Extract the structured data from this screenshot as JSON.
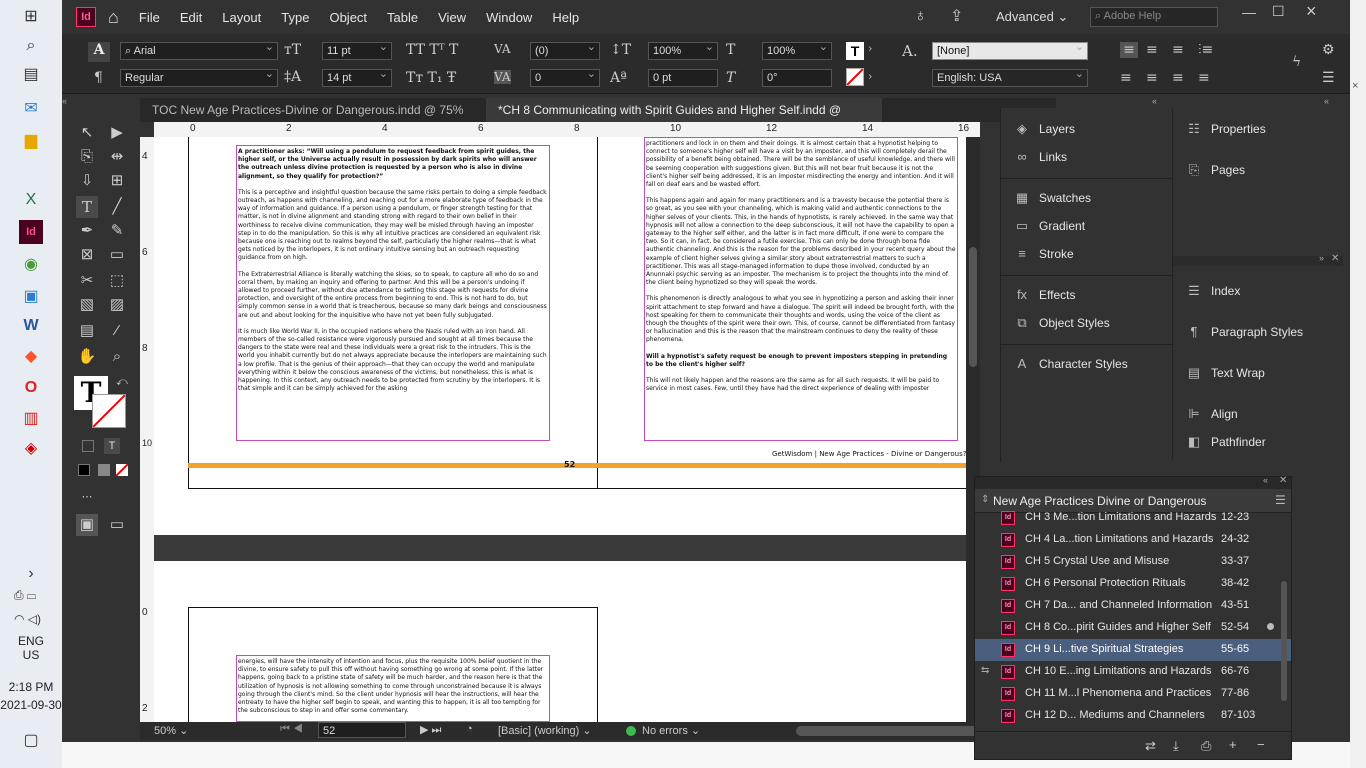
{
  "taskbar": {
    "time": "2:18 PM",
    "date": "2021-09-30",
    "lang1": "ENG",
    "lang2": "US"
  },
  "menubar": {
    "app_icon": "Id",
    "items": [
      "File",
      "Edit",
      "Layout",
      "Type",
      "Object",
      "Table",
      "View",
      "Window",
      "Help"
    ],
    "workspace": "Advanced",
    "search_placeholder": "Adobe Help"
  },
  "control": {
    "font": "Arial",
    "style": "Regular",
    "size": "11 pt",
    "leading": "14 pt",
    "kerning": "(0)",
    "tracking": "0",
    "vscale": "100%",
    "hscale": "100%",
    "baseline": "0 pt",
    "skew": "0°",
    "char_style": "[None]",
    "language": "English: USA"
  },
  "tabs": [
    {
      "label": "TOC New Age Practices-Divine or Dangerous.indd @ 75%"
    },
    {
      "label": "*CH 8 Communicating with Spirit Guides and Higher Self.indd @ 50%"
    }
  ],
  "ruler": {
    "h": [
      "0",
      "2",
      "4",
      "6",
      "8",
      "10",
      "12",
      "14",
      "16"
    ],
    "v": [
      "4",
      "6",
      "8",
      "10",
      "0",
      "2"
    ]
  },
  "document": {
    "left_col": [
      "A practitioner asks: “Will using a pendulum to request feedback from spirit guides, the higher self, or the Universe actually result in possession by dark spirits who will answer the outreach unless divine protection is requested by a person who is also in divine alignment, so they qualify for protection?”",
      "This is a perceptive and insightful question because the same risks pertain to doing a simple feedback outreach, as happens with channeling, and reaching out for a more elaborate type of feedback in the way of information and guidance. If a person using a pendulum, or finger strength testing for that matter, is not in divine alignment and standing strong with regard to their own belief in their worthiness to receive divine communication, they may well be misled through having an imposter step in to do the manipulation. So this is why all intuitive practices are considered an equivalent risk because one is reaching out to realms beyond the self, particularly the higher realms—that is what gets noticed by the interlopers, it is not ordinary intuitive sensing but an outreach requesting guidance from on high.",
      "The Extraterrestrial Alliance is literally watching the skies, so to speak, to capture all who do so and corral them, by making an inquiry and offering to partner. And this will be a person's undoing if allowed to proceed further, without due attendance to setting this stage with requests for divine protection, and oversight of the entire process from beginning to end. This is not hard to do, but simply common sense in a world that is treacherous, because so many dark beings and consciousness are out and about looking for the inquisitive who have not yet been fully subjugated.",
      "It is much like World War II, in the occupied nations where the Nazis ruled with an iron hand. All members of the so-called resistance were vigorously pursued and sought at all times because the dangers to the state were real and these individuals were a great risk to the intruders. This is the world you inhabit currently but do not always appreciate because the interlopers are maintaining such a low profile. That is the genius of their approach—that they can occupy the world and manipulate everything within it below the conscious awareness of the victims, but nonetheless, this is what is happening. In this context, any outreach needs to be protected from scrutiny by the interlopers. It is that simple and it can be simply achieved for the asking"
    ],
    "right_col": [
      "practitioners and lock in on them and their doings. It is almost certain that a hypnotist helping to connect to someone's higher self will have a visit by an imposter, and this will completely derail the possibility of a benefit being obtained. There will be the semblance of useful knowledge, and there will be seeming cooperation with suggestions given. But this will not bear fruit because it is not the client's higher self being addressed, it is an imposter misdirecting the energy and intention. And it will fall on deaf ears and be wasted effort.",
      "This happens again and again for many practitioners and is a travesty because the potential there is so great, as you see with your channeling, which is making valid and authentic connections to the higher selves of your clients. This, in the hands of hypnotists, is rarely achieved. In the same way that hypnosis will not allow a connection to the deep subconscious, it will not have the capability to open a gateway to the higher self either, and the latter is in fact more difficult, if one were to compare the two. So it can, in fact, be considered a futile exercise. This can only be done through bona fide authentic channeling. And this is the reason for the problems described in your recent query about the example of client higher selves giving a similar story about extraterrestrial matters to such a practitioner. This was all stage-managed information to dupe those involved, conducted by an Anunnaki psychic serving as an imposter. The mechanism is to project the thoughts into the mind of the client being hypnotized so they will speak the words.",
      "This phenomenon is directly analogous to what you see in hypnotizing a person and asking their inner spirit attachment to step forward and have a dialogue. The spirit will indeed be brought forth, with the host speaking for them to communicate their thoughts and words, using the voice of the client as though the thoughts of the spirit were their own. This, of course, cannot be differentiated from fantasy or hallucination and this is the reason that the mainstream continues to deny the reality of these phenomena.",
      "Will a hypnotist's safety request be enough to prevent imposters stepping in pretending to be the client's higher self?",
      "This will not likely happen and the reasons are the same as for all such requests. It will be paid to service in most cases. Few, until they have had the direct experience of dealing with imposter"
    ],
    "page_number": "52",
    "footer": "GetWisdom | New Age Practices - Divine or Dangerous?",
    "next_page_text": "energies, will have the intensity of intention and focus, plus the requisite 100% belief quotient in the divine, to ensure safety to pull this off without having something go wrong at some point. If the latter happens, going back to a pristine state of safety will be much harder, and the reason here is that the utilization of hypnosis is not allowing something to come through unconstrained because it is always going through the client's mind. So the client under hypnosis will hear the instructions, will hear the entreaty to have the higher self begin to speak, and wanting this to happen, it is all too tempting for the subconscious to step in and offer some commentary."
  },
  "status": {
    "zoom": "50%",
    "page": "52",
    "preflight_profile": "[Basic] (working)",
    "errors": "No errors"
  },
  "panels": {
    "col1": [
      "Layers",
      "Links",
      "Swatches",
      "Gradient",
      "Stroke",
      "Effects",
      "Object Styles",
      "Character Styles"
    ],
    "col2a": [
      "Properties",
      "Pages"
    ],
    "col2b": [
      "Index",
      "Paragraph Styles",
      "Text Wrap",
      "Align",
      "Pathfinder"
    ]
  },
  "book": {
    "title": "New Age Practices Divine or Dangerous",
    "rows": [
      {
        "name": "CH 3 Me...tion Limitations and Hazards",
        "pages": "12-23"
      },
      {
        "name": "CH 4 La...tion Limitations and Hazards",
        "pages": "24-32"
      },
      {
        "name": "CH 5 Crystal Use and Misuse",
        "pages": "33-37"
      },
      {
        "name": "CH 6 Personal Protection Rituals",
        "pages": "38-42"
      },
      {
        "name": "CH 7 Da... and Channeled Information",
        "pages": "43-51"
      },
      {
        "name": "CH 8 Co...pirit Guides and Higher Self",
        "pages": "52-54"
      },
      {
        "name": "CH 9 Li...tive Spiritual Strategies",
        "pages": "55-65"
      },
      {
        "name": "CH 10 E...ing Limitations and Hazards",
        "pages": "66-76"
      },
      {
        "name": "CH 11 M...l Phenomena and Practices",
        "pages": "77-86"
      },
      {
        "name": "CH 12 D... Mediums and Channelers",
        "pages": "87-103"
      }
    ],
    "selected_index": 6
  }
}
